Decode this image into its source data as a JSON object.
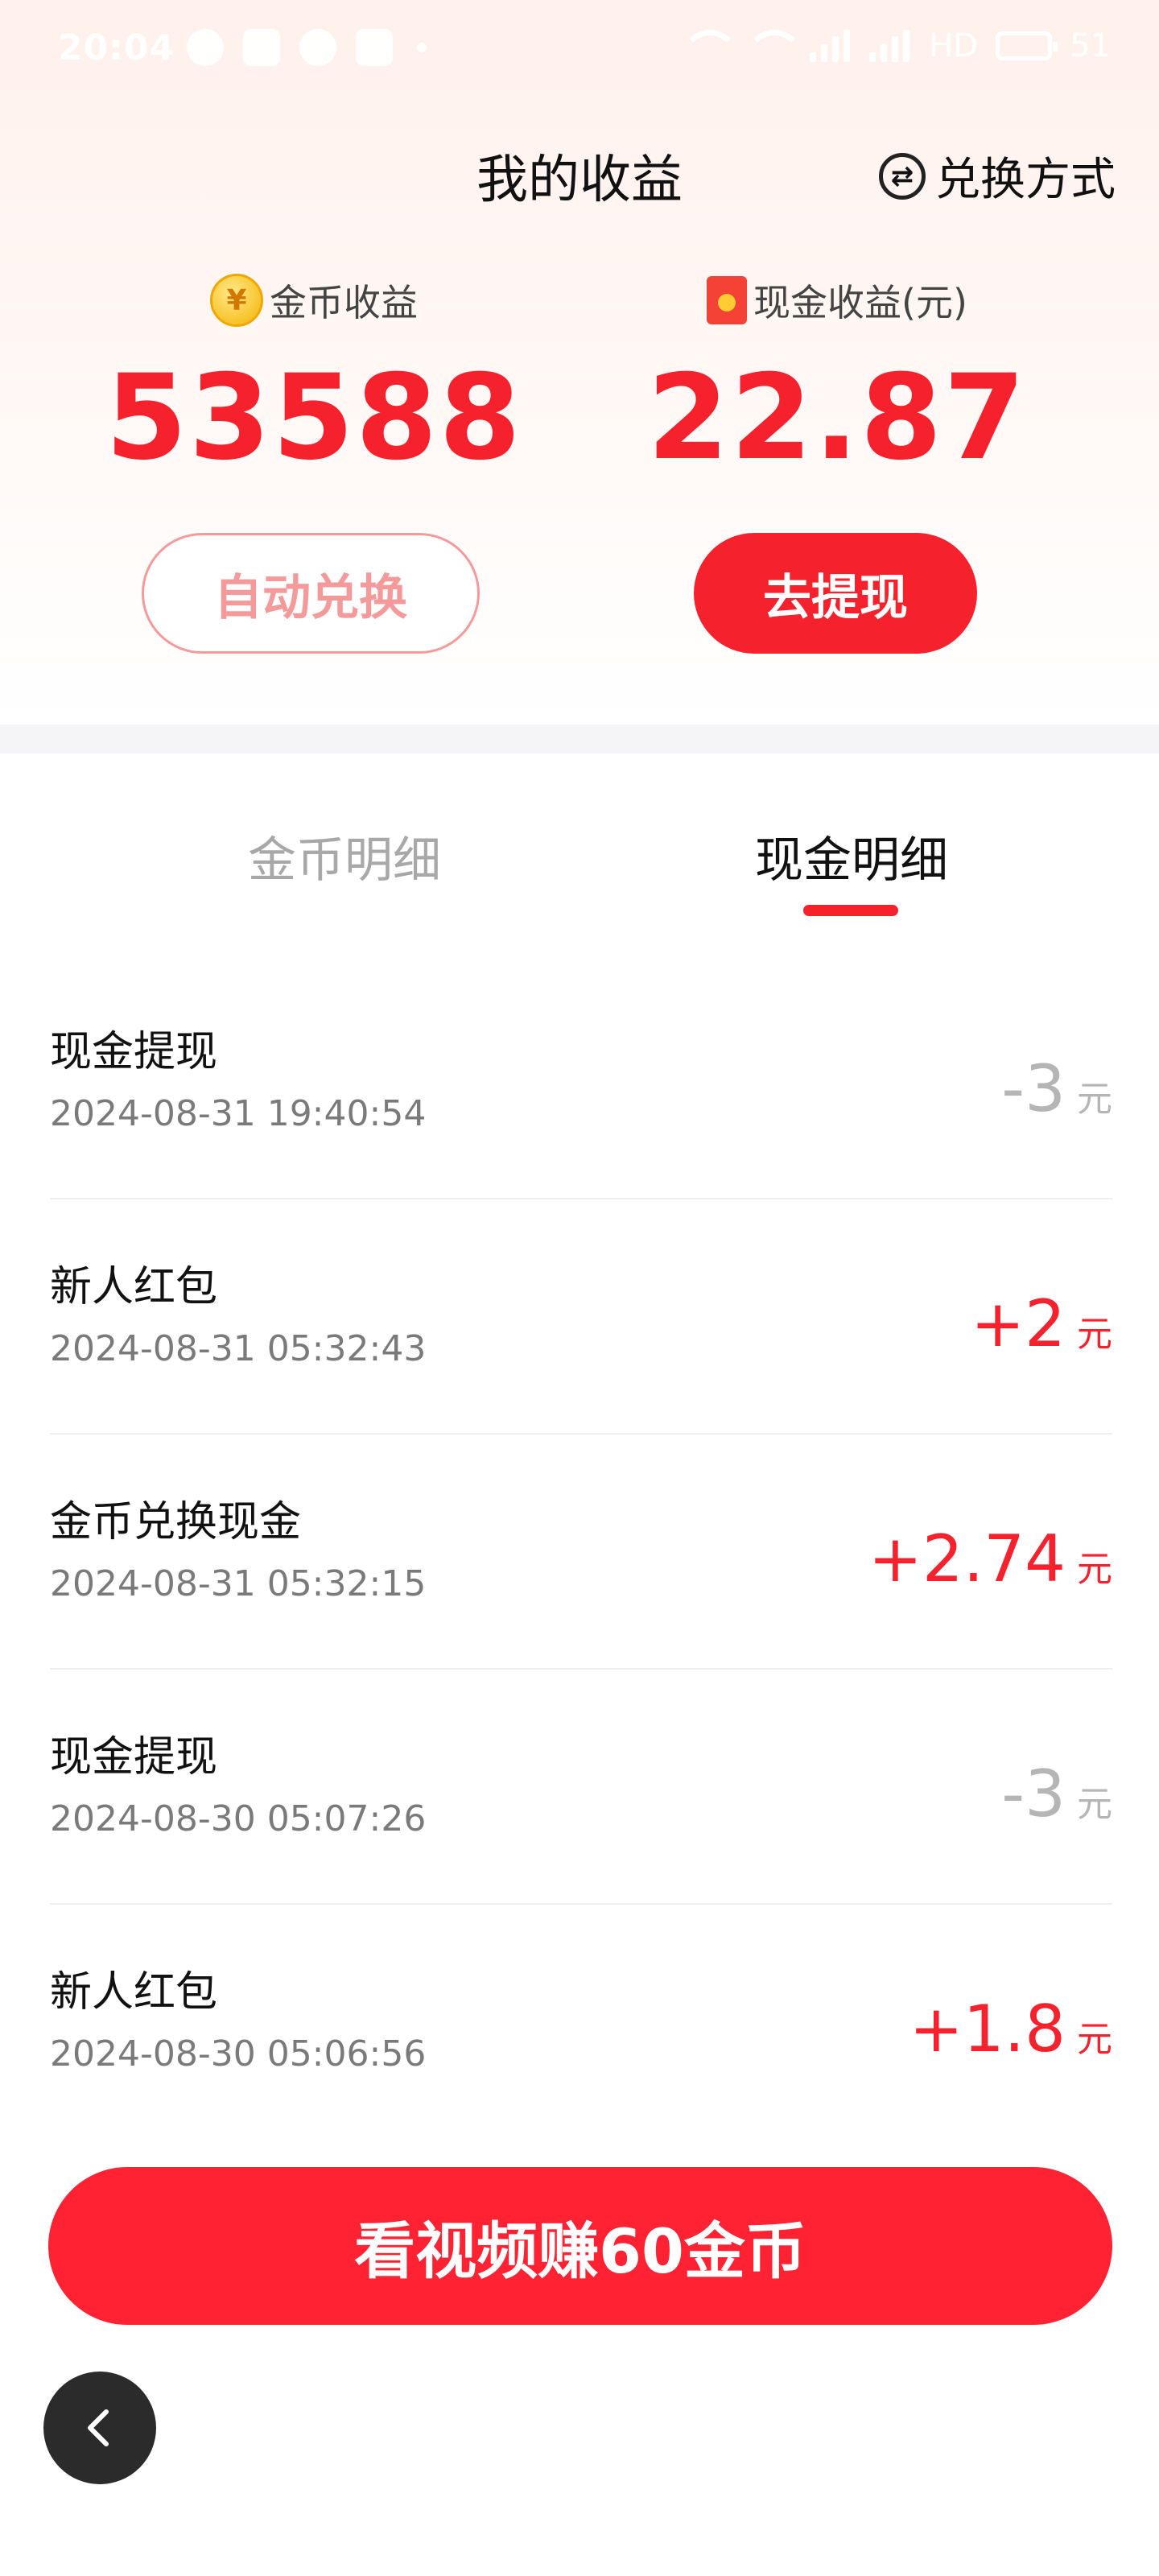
{
  "status_bar": {
    "time": "20:04",
    "battery": "51",
    "network": "HD"
  },
  "header": {
    "title": "我的收益",
    "exchange_method": "兑换方式"
  },
  "earnings": {
    "coin": {
      "label": "金币收益",
      "value": "53588",
      "coin_symbol": "¥"
    },
    "cash": {
      "label": "现金收益(元)",
      "value": "22.87"
    }
  },
  "buttons": {
    "auto_exchange": "自动兑换",
    "withdraw": "去提现",
    "watch_video": "看视频赚60金币"
  },
  "tabs": [
    {
      "label": "金币明细"
    },
    {
      "label": "现金明细"
    }
  ],
  "records": [
    {
      "title": "现金提现",
      "time": "2024-08-31 19:40:54",
      "amount": "-3",
      "unit": "元"
    },
    {
      "title": "新人红包",
      "time": "2024-08-31 05:32:43",
      "amount": "+2",
      "unit": "元"
    },
    {
      "title": "金币兑换现金",
      "time": "2024-08-31 05:32:15",
      "amount": "+2.74",
      "unit": "元"
    },
    {
      "title": "现金提现",
      "time": "2024-08-30 05:07:26",
      "amount": "-3",
      "unit": "元"
    },
    {
      "title": "新人红包",
      "time": "2024-08-30 05:06:56",
      "amount": "+1.8",
      "unit": "元"
    }
  ],
  "icons": {
    "exchange": "exchange-icon",
    "coin": "coin-icon",
    "envelope": "red-envelope-icon",
    "back": "chevron-left-icon"
  },
  "colors": {
    "accent": "#f5222d",
    "negative": "#b5b5b5",
    "back_button": "#2b2b2b"
  }
}
